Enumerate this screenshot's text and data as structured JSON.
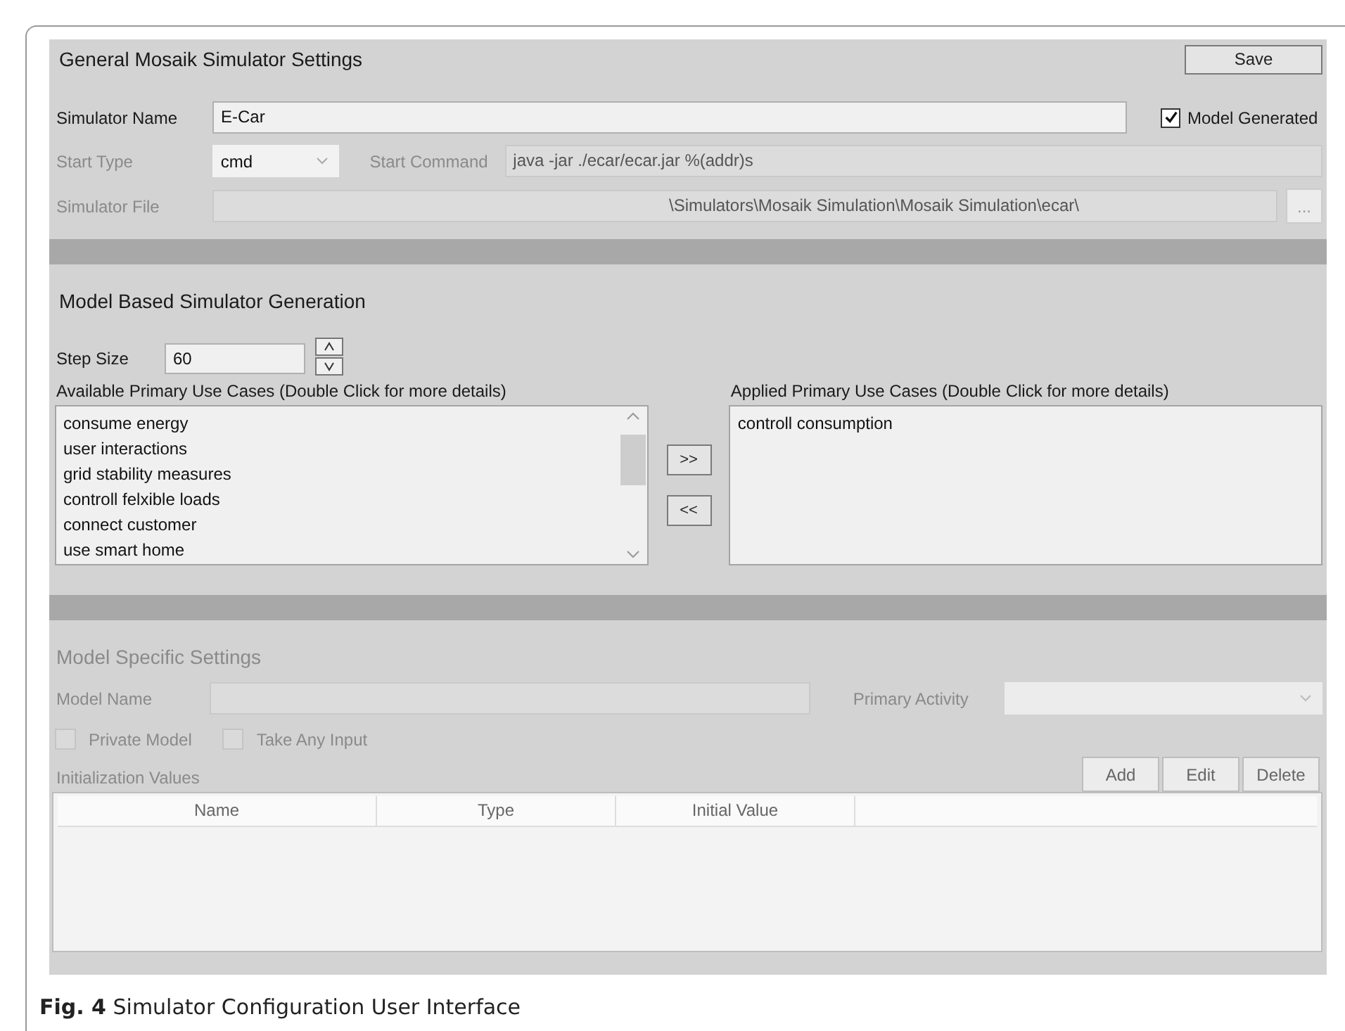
{
  "general": {
    "title": "General Mosaik Simulator Settings",
    "save_button": "Save",
    "simulator_name": {
      "label": "Simulator Name",
      "value": "E-Car",
      "disabled": false
    },
    "model_generated": {
      "label": "Model Generated",
      "checked": true
    },
    "start_type": {
      "label": "Start Type",
      "value": "cmd",
      "disabled": true
    },
    "start_command": {
      "label": "Start Command",
      "value": "java -jar ./ecar/ecar.jar %(addr)s",
      "disabled": true
    },
    "simulator_file": {
      "label": "Simulator File",
      "value": "\\Simulators\\Mosaik Simulation\\Mosaik Simulation\\ecar\\",
      "disabled": true
    },
    "browse_button": "..."
  },
  "generation": {
    "title": "Model Based Simulator Generation",
    "step_size": {
      "label": "Step Size",
      "value": "60"
    },
    "available": {
      "label": "Available Primary Use Cases (Double Click for more details)",
      "items": [
        "consume energy",
        "user interactions",
        "grid stability measures",
        "controll felxible loads",
        "connect customer",
        "use smart home"
      ]
    },
    "add_button": ">>",
    "remove_button": "<<",
    "applied": {
      "label": "Applied Primary Use Cases (Double Click for more details)",
      "items": [
        "controll consumption"
      ]
    }
  },
  "model_settings": {
    "title": "Model Specific Settings",
    "disabled": true,
    "model_name": {
      "label": "Model Name"
    },
    "primary_activity": {
      "label": "Primary Activity"
    },
    "checkboxes": [
      {
        "label": "Private Model",
        "checked": false
      },
      {
        "label": "Take Any Input",
        "checked": false
      }
    ],
    "init_label": "Initialization Values",
    "buttons": [
      "Add",
      "Edit",
      "Delete"
    ],
    "table": {
      "columns": [
        "Name",
        "Type",
        "Initial Value"
      ]
    }
  },
  "caption": "**Fig. 4** Simulator Configuration User Interface"
}
